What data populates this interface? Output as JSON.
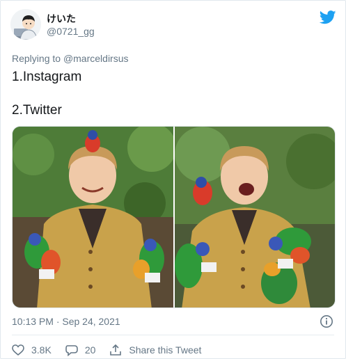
{
  "tweet": {
    "display_name": "けいた",
    "handle": "@0721_gg",
    "reply_prefix": "Replying to",
    "reply_mention": "@marceldirsus",
    "lines": [
      "1.Instagram",
      "2.Twitter"
    ],
    "timestamp": "10:13 PM · Sep 24, 2021"
  },
  "actions": {
    "likes": "3.8K",
    "replies": "20",
    "share_label": "Share this Tweet"
  },
  "icons": {
    "brand": "twitter-bird-icon",
    "info": "info-icon",
    "like": "heart-icon",
    "reply": "reply-bubble-icon",
    "share": "share-icon"
  },
  "colors": {
    "twitter_blue": "#1da1f2",
    "secondary_text": "#657786",
    "primary_text": "#14171a"
  }
}
